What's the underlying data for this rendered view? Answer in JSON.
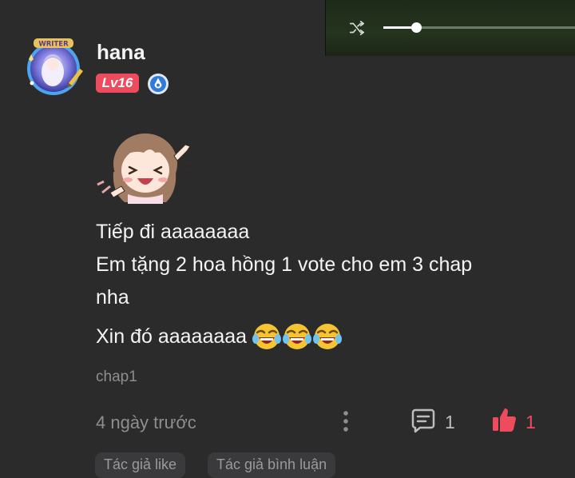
{
  "video": {
    "progress": 0.17
  },
  "comment": {
    "username": "hana",
    "level_badge": "Lv16",
    "avatar_label": "WRITER",
    "sticker": "laughing-girl-sticker",
    "lines": [
      "Tiếp đi aaaaaaaa",
      "Em tặng 2 hoa hồng 1 vote cho em 3 chap",
      "nha"
    ],
    "last_line": "Xin đó aaaaaaaa",
    "emoji_count": 3,
    "chapter": "chap1",
    "time": "4 ngày trước",
    "reply_count": "1",
    "like_count": "1"
  },
  "tags": [
    "Tác giả like",
    "Tác giả bình luận"
  ],
  "colors": {
    "background": "#2b2b2c",
    "accent": "#ef4b5f",
    "muted_text": "#8e8e8e",
    "verify_blue": "#2f7bd8"
  }
}
